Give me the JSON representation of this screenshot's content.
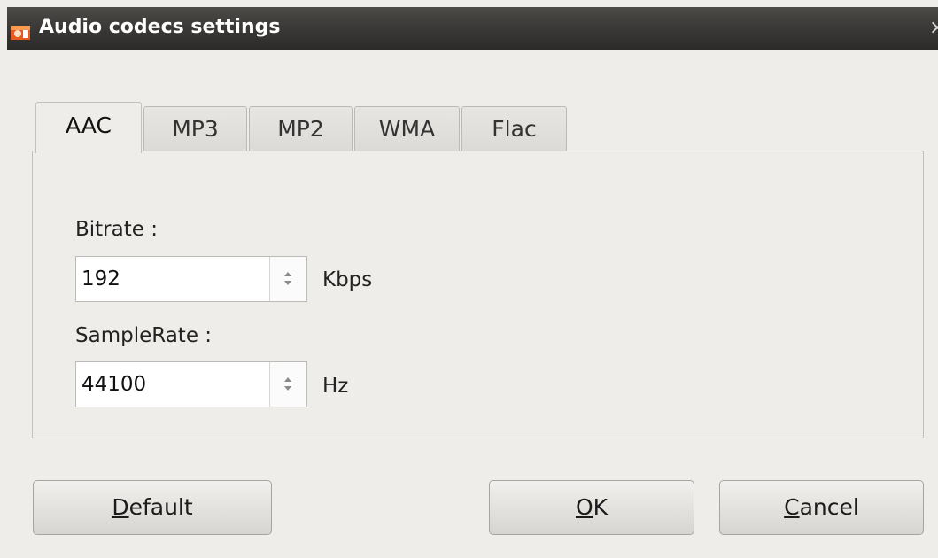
{
  "window": {
    "title": "Audio codecs settings",
    "close_glyph": "×",
    "icon": "app-icon"
  },
  "tabs": [
    {
      "label": "AAC",
      "active": true
    },
    {
      "label": "MP3",
      "active": false
    },
    {
      "label": "MP2",
      "active": false
    },
    {
      "label": "WMA",
      "active": false
    },
    {
      "label": "Flac",
      "active": false
    }
  ],
  "bitrate": {
    "label": "Bitrate :",
    "value": "192",
    "unit": "Kbps"
  },
  "samplerate": {
    "label": "SampleRate :",
    "value": "44100",
    "unit": "Hz"
  },
  "buttons": {
    "default": {
      "mnemonic": "D",
      "rest": "efault"
    },
    "ok": {
      "mnemonic": "O",
      "rest": "K"
    },
    "cancel": {
      "mnemonic": "C",
      "rest": "ancel"
    }
  },
  "colors": {
    "titlebar": "#3b3a38",
    "background": "#efedea"
  }
}
